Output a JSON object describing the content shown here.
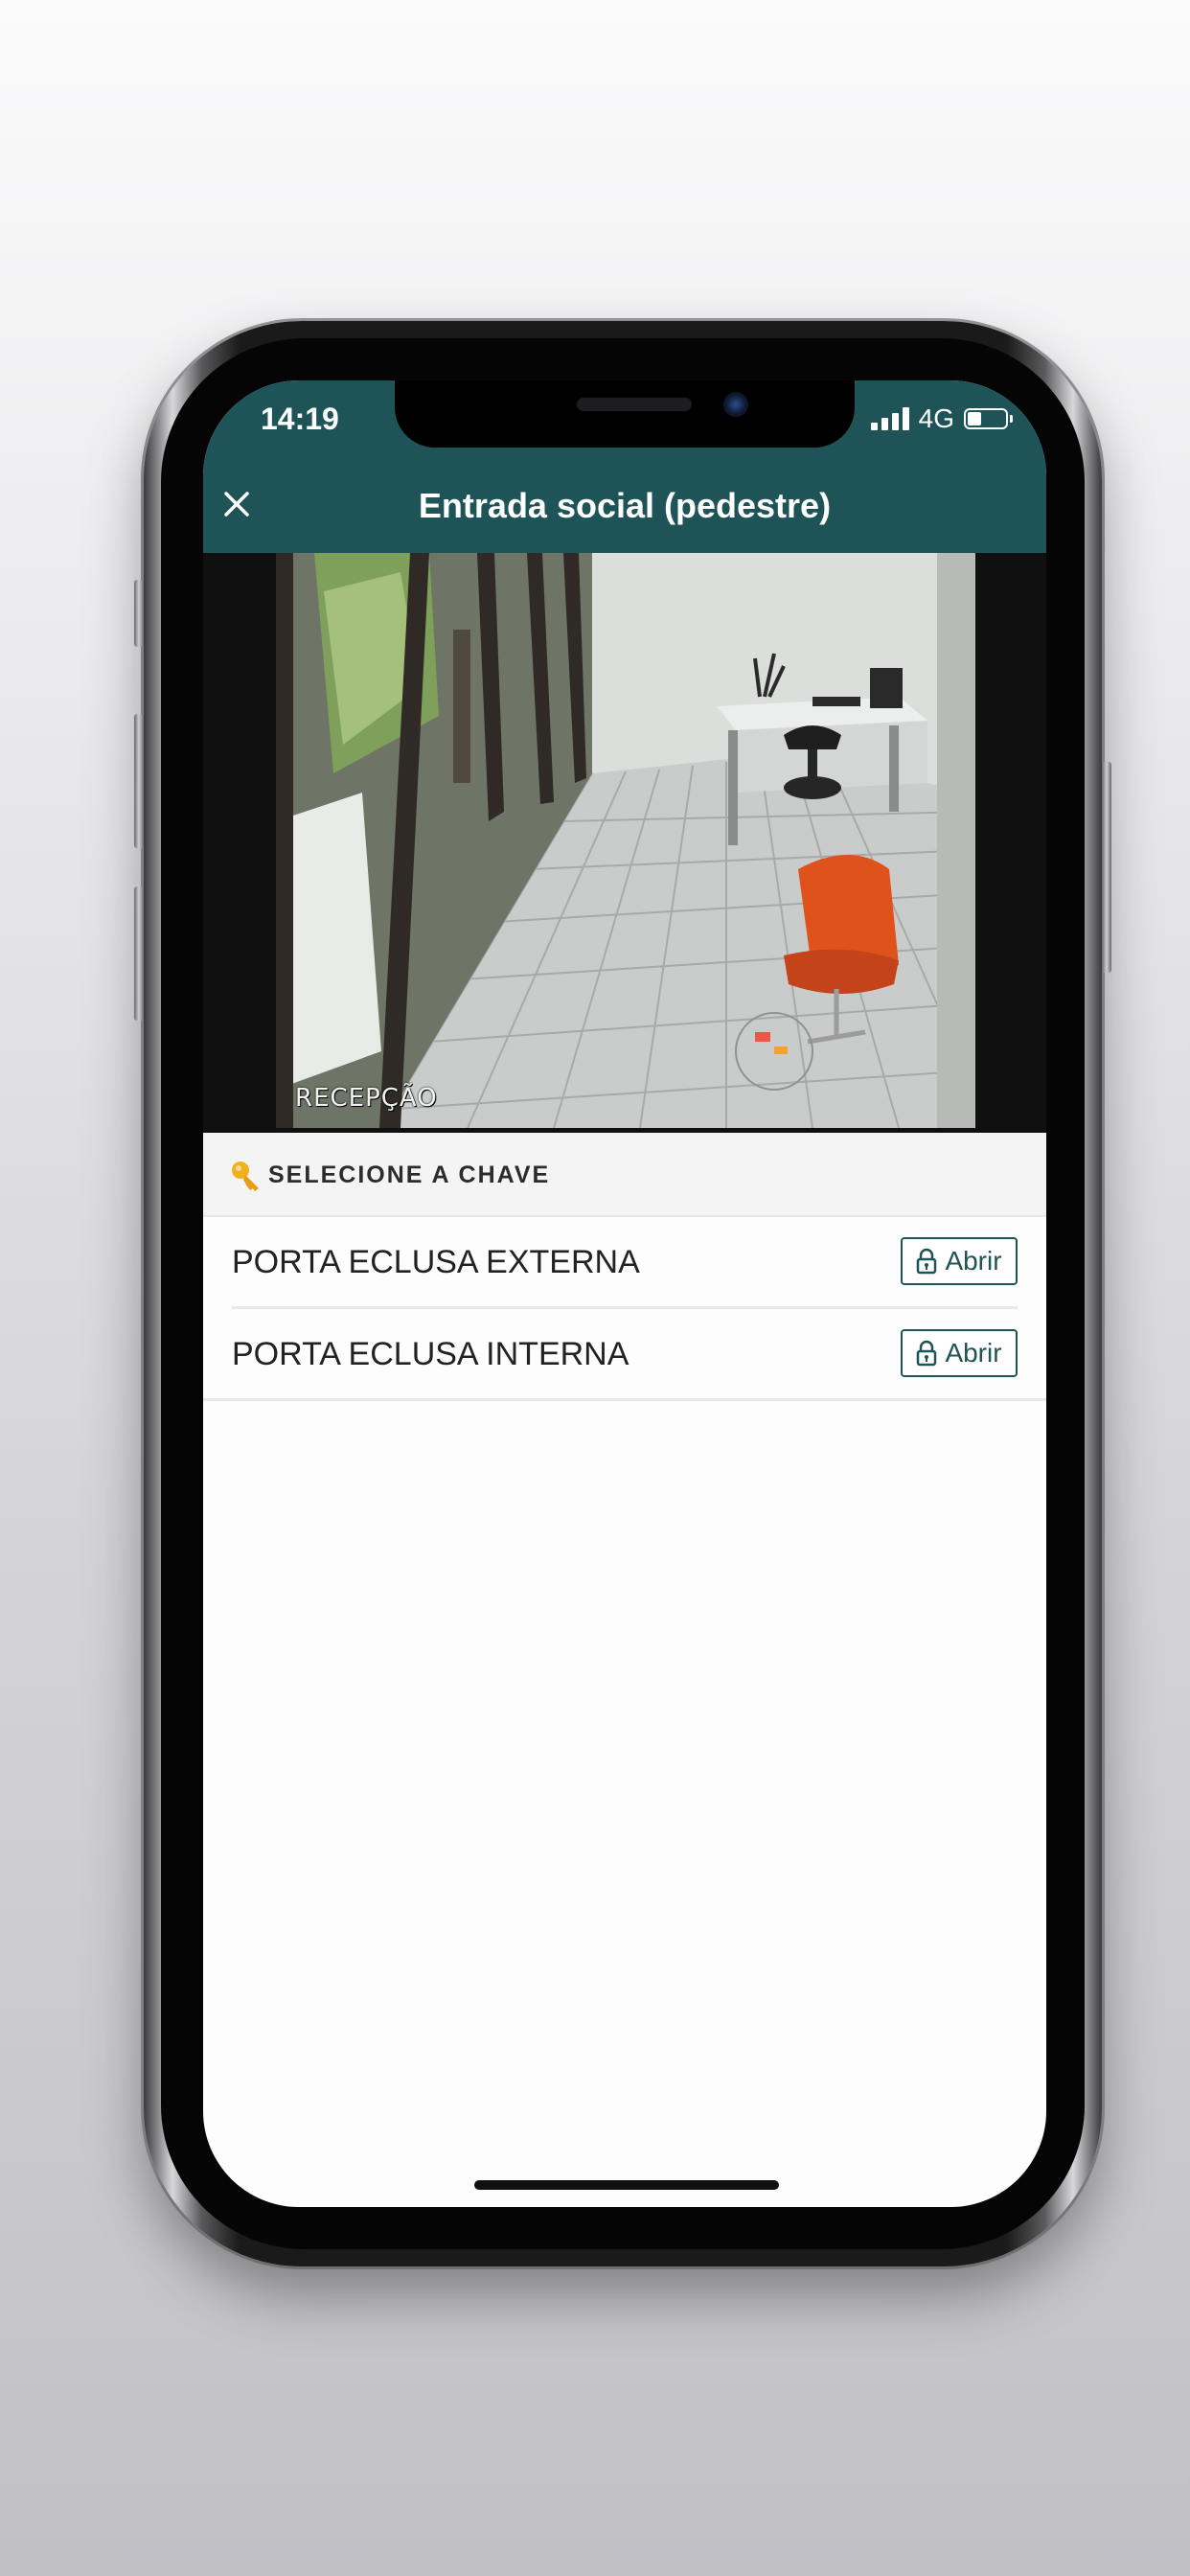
{
  "status_bar": {
    "time": "14:19",
    "network": "4G"
  },
  "header": {
    "title": "Entrada social (pedestre)",
    "close_icon": "close-icon"
  },
  "camera_feed": {
    "caption": "RECEPÇÃO"
  },
  "keys": {
    "section_label": "SELECIONE A CHAVE",
    "items": [
      {
        "name": "PORTA ECLUSA EXTERNA",
        "button_label": "Abrir"
      },
      {
        "name": "PORTA ECLUSA INTERNA",
        "button_label": "Abrir"
      }
    ]
  },
  "colors": {
    "brand": "#1e5458",
    "key_accent": "#f2b01e"
  }
}
